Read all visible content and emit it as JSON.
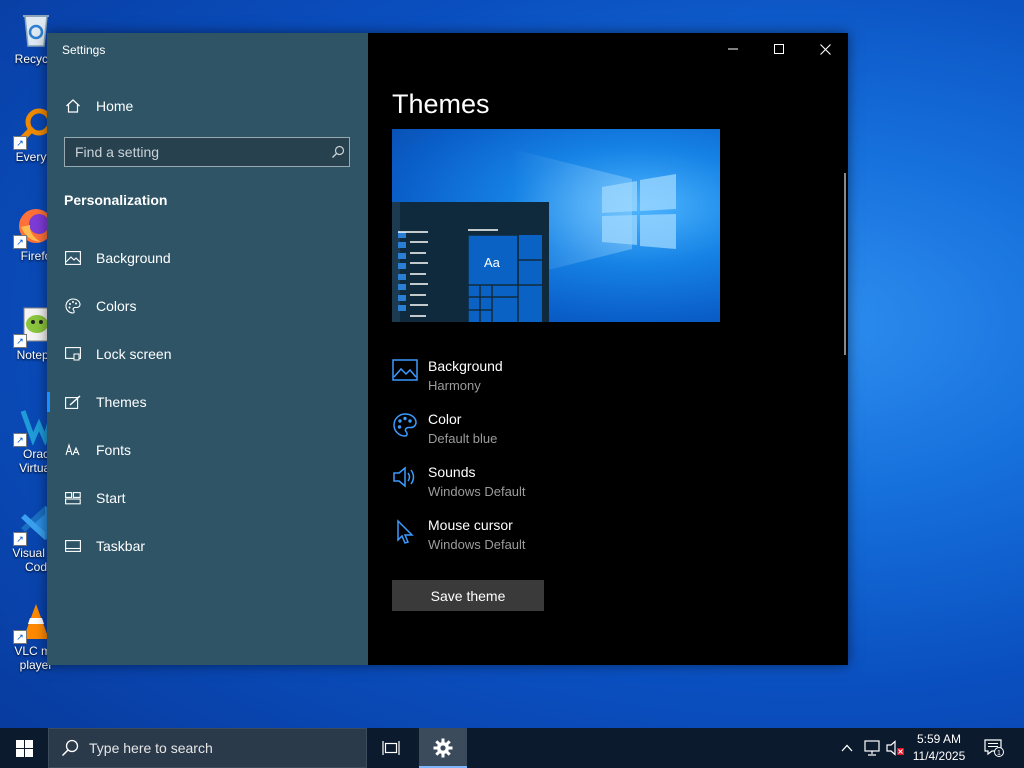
{
  "desktop": {
    "icons": [
      {
        "label": "Recycle Bin",
        "shown": "Recycle"
      },
      {
        "label": "Everything",
        "shown": "Everyth"
      },
      {
        "label": "Firefox",
        "shown": "Firefo"
      },
      {
        "label": "Notepad++",
        "shown": "Notepa"
      },
      {
        "label": "Oracle VirtualBox",
        "shown1": "Orac",
        "shown2": "Virtual"
      },
      {
        "label": "Visual Studio Code",
        "shown1": "Visual St",
        "shown2": "Cod"
      },
      {
        "label": "VLC media player",
        "shown1": "VLC me",
        "shown2": "player"
      }
    ]
  },
  "window": {
    "title": "Settings",
    "home_label": "Home",
    "search": {
      "placeholder": "Find a setting",
      "value": ""
    },
    "section_title": "Personalization",
    "nav": [
      {
        "label": "Background",
        "icon": "picture-icon"
      },
      {
        "label": "Colors",
        "icon": "palette-icon"
      },
      {
        "label": "Lock screen",
        "icon": "lock-screen-icon"
      },
      {
        "label": "Themes",
        "icon": "themes-icon",
        "active": true
      },
      {
        "label": "Fonts",
        "icon": "fonts-icon"
      },
      {
        "label": "Start",
        "icon": "start-icon"
      },
      {
        "label": "Taskbar",
        "icon": "taskbar-icon"
      }
    ],
    "page_title": "Themes",
    "preview_sample_text": "Aa",
    "properties": [
      {
        "name": "Background",
        "value": "Harmony",
        "icon": "picture-icon"
      },
      {
        "name": "Color",
        "value": "Default blue",
        "icon": "palette-icon"
      },
      {
        "name": "Sounds",
        "value": "Windows Default",
        "icon": "speaker-icon"
      },
      {
        "name": "Mouse cursor",
        "value": "Windows Default",
        "icon": "cursor-icon"
      }
    ],
    "save_button": "Save theme",
    "sidebar_color": "#2e5466",
    "accent_color": "#1a8fff"
  },
  "taskbar": {
    "search_placeholder": "Type here to search",
    "time": "5:59 AM",
    "date": "11/4/2025",
    "notification_count": "1"
  }
}
